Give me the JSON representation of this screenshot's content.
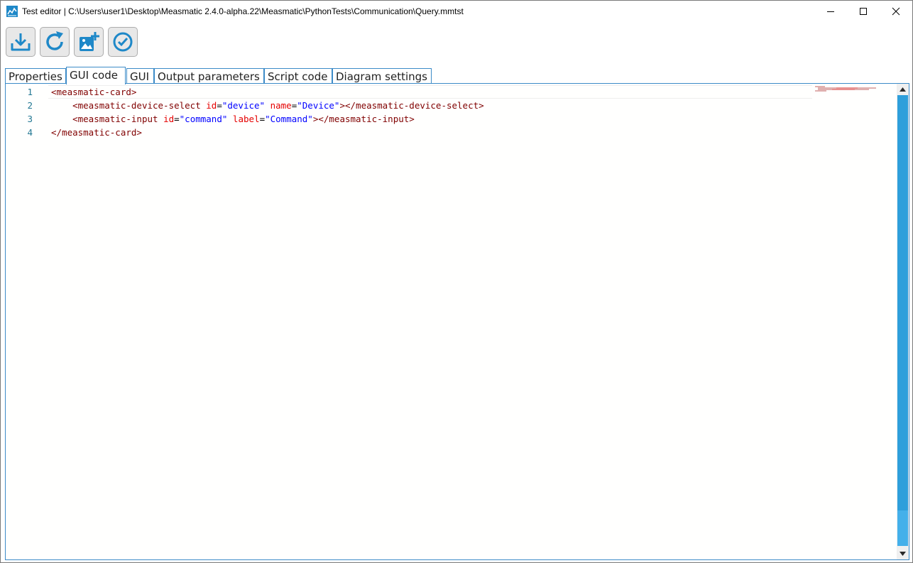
{
  "window": {
    "title": "Test editor | C:\\Users\\user1\\Desktop\\Measmatic 2.4.0-alpha.22\\Measmatic\\PythonTests\\Communication\\Query.mmtst",
    "app_icon": "measmatic-app-icon"
  },
  "toolbar": {
    "buttons": [
      {
        "icon": "download-icon"
      },
      {
        "icon": "refresh-icon"
      },
      {
        "icon": "add-image-icon"
      },
      {
        "icon": "check-circle-icon"
      }
    ],
    "accent": "#1e88c8"
  },
  "tabs": [
    {
      "label": "Properties",
      "active": false
    },
    {
      "label": "GUI code",
      "active": true
    },
    {
      "label": "GUI",
      "active": false
    },
    {
      "label": "Output parameters",
      "active": false
    },
    {
      "label": "Script code",
      "active": false
    },
    {
      "label": "Diagram settings",
      "active": false
    }
  ],
  "editor": {
    "line_numbers": [
      "1",
      "2",
      "3",
      "4"
    ],
    "lines": [
      {
        "indent": "",
        "open": "<measmatic-card>"
      },
      {
        "indent": "    ",
        "tag": "<measmatic-device-select",
        "attr1": "id",
        "val1": "\"device\"",
        "attr2": "name",
        "val2": "\"Device\"",
        "close": "></measmatic-device-select>"
      },
      {
        "indent": "    ",
        "tag": "<measmatic-input",
        "attr1": "id",
        "val1": "\"command\"",
        "attr2": "label",
        "val2": "\"Command\"",
        "close": "></measmatic-input>"
      },
      {
        "indent": "",
        "open": "</measmatic-card>"
      }
    ],
    "colors": {
      "tag": "#800000",
      "attribute": "#e50000",
      "string": "#0000ff",
      "line_number": "#237893",
      "scrollbar_thumb": "#2e9fdb"
    }
  }
}
